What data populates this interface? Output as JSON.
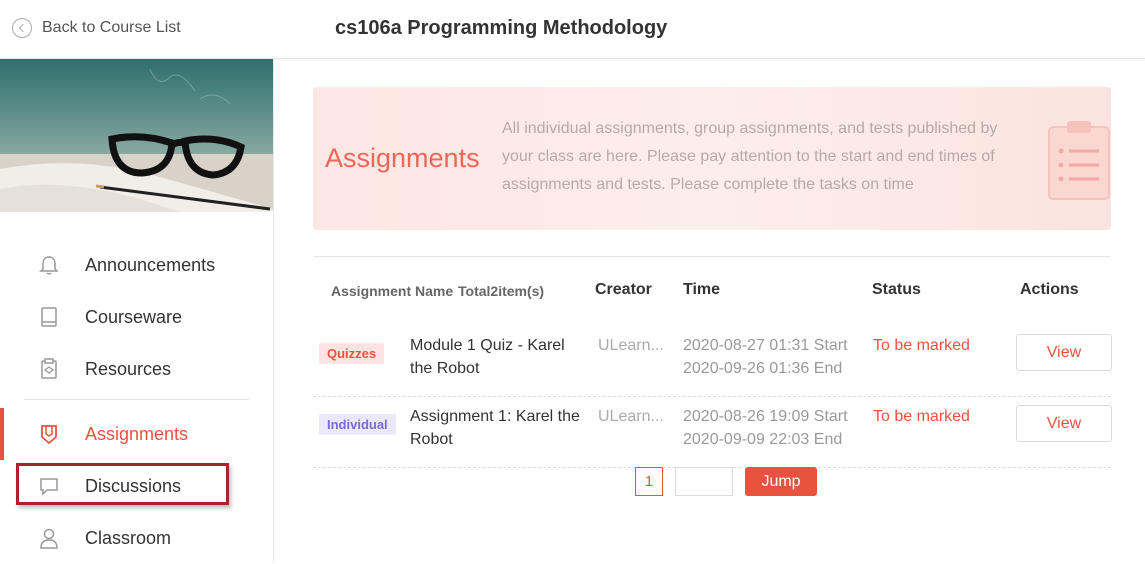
{
  "header": {
    "back_label": "Back to Course List",
    "course_title": "cs106a Programming Methodology"
  },
  "sidebar": {
    "items": [
      {
        "label": "Announcements",
        "icon": "bell-icon",
        "active": false
      },
      {
        "label": "Courseware",
        "icon": "book-icon",
        "active": false
      },
      {
        "label": "Resources",
        "icon": "resources-icon",
        "active": false
      },
      {
        "label": "Assignments",
        "icon": "assignment-icon",
        "active": true
      },
      {
        "label": "Discussions",
        "icon": "chat-icon",
        "active": false
      },
      {
        "label": "Classroom",
        "icon": "person-icon",
        "active": false
      }
    ]
  },
  "hero": {
    "title": "Assignments",
    "description": "All individual assignments, group assignments, and tests published by your class are here. Please pay attention to the start and end times of assignments and tests. Please complete the tasks on time"
  },
  "table": {
    "headers": {
      "name": "Assignment Name",
      "total": "Total2item(s)",
      "creator": "Creator",
      "time": "Time",
      "status": "Status",
      "actions": "Actions"
    },
    "rows": [
      {
        "tag": "Quizzes",
        "name": "Module 1 Quiz - Karel the Robot",
        "creator": "ULearn...",
        "start": "2020-08-27 01:31 Start",
        "end": "2020-09-26 01:36 End",
        "status": "To be marked",
        "action": "View"
      },
      {
        "tag": "Individual",
        "name": "Assignment 1: Karel the Robot",
        "creator": "ULearn...",
        "start": "2020-08-26 19:09 Start",
        "end": "2020-09-09 22:03 End",
        "status": "To be marked",
        "action": "View"
      }
    ]
  },
  "pagination": {
    "current_page": "1",
    "input_value": "",
    "jump_label": "Jump"
  },
  "colors": {
    "accent": "#e8533f",
    "highlight_box": "#a8232c"
  }
}
